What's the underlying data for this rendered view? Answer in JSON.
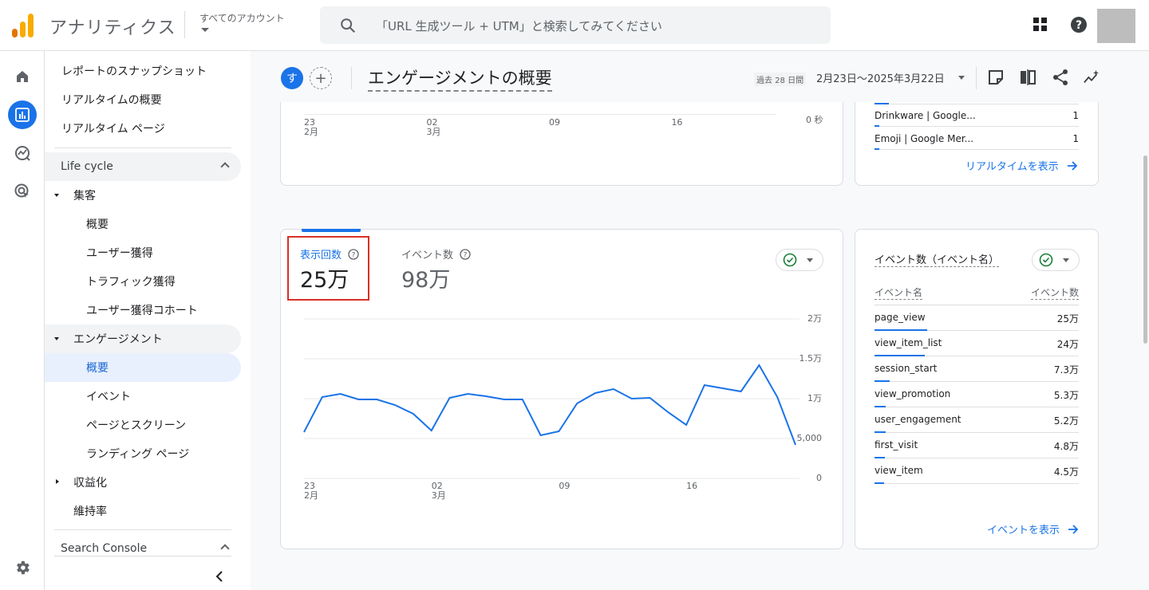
{
  "topbar": {
    "app_title": "アナリティクス",
    "account_label": "すべてのアカウント",
    "search_placeholder": "「URL 生成ツール + UTM」と検索してみてください"
  },
  "rail": {
    "items": [
      "home-icon",
      "reports-icon",
      "explore-icon",
      "advertising-icon"
    ],
    "settings": "settings-icon"
  },
  "sidenav": {
    "snapshot": "レポートのスナップショット",
    "realtime_overview": "リアルタイムの概要",
    "realtime_pages": "リアルタイム ページ",
    "lifecycle": "Life cycle",
    "acquisition": "集客",
    "acq_overview": "概要",
    "user_acq": "ユーザー獲得",
    "traffic_acq": "トラフィック獲得",
    "user_acq_cohort": "ユーザー獲得コホート",
    "engagement": "エンゲージメント",
    "eng_overview": "概要",
    "events": "イベント",
    "pages_screens": "ページとスクリーン",
    "landing_page": "ランディング ページ",
    "monetization": "収益化",
    "retention": "維持率",
    "search_console": "Search Console"
  },
  "header": {
    "segment_chip": "す",
    "add_chip": "+",
    "page_title": "エンゲージメントの概要",
    "date_label": "過去 28 日間",
    "date_range": "2月23日〜2025年3月22日"
  },
  "top_card": {
    "x_ticks": [
      {
        "day": "23",
        "month": "2月"
      },
      {
        "day": "02",
        "month": "3月"
      },
      {
        "day": "09",
        "month": ""
      },
      {
        "day": "16",
        "month": ""
      }
    ],
    "y_zero": "0 秒"
  },
  "realtime_card": {
    "rows": [
      {
        "name": "Drinkware | Google...",
        "value": "1"
      },
      {
        "name": "Emoji | Google Mer...",
        "value": "1"
      }
    ],
    "link": "リアルタイムを表示"
  },
  "views_card": {
    "metric1_label": "表示回数",
    "metric1_value": "25万",
    "metric2_label": "イベント数",
    "metric2_value": "98万",
    "y_ticks": [
      "2万",
      "1.5万",
      "1万",
      "5,000",
      "0"
    ],
    "x_ticks": [
      {
        "day": "23",
        "month": "2月"
      },
      {
        "day": "02",
        "month": "3月"
      },
      {
        "day": "09",
        "month": ""
      },
      {
        "day": "16",
        "month": ""
      }
    ]
  },
  "chart_data": {
    "type": "line",
    "title": "",
    "xlabel": "",
    "ylabel": "",
    "ylim": [
      0,
      20000
    ],
    "x": [
      "2月23日",
      "2月24日",
      "2月25日",
      "2月26日",
      "2月27日",
      "2月28日",
      "3月1日",
      "3月2日",
      "3月3日",
      "3月4日",
      "3月5日",
      "3月6日",
      "3月7日",
      "3月8日",
      "3月9日",
      "3月10日",
      "3月11日",
      "3月12日",
      "3月13日",
      "3月14日",
      "3月15日",
      "3月16日",
      "3月17日",
      "3月18日",
      "3月19日",
      "3月20日",
      "3月21日",
      "3月22日"
    ],
    "series": [
      {
        "name": "表示回数",
        "values": [
          5800,
          10200,
          10600,
          9900,
          9900,
          9200,
          8100,
          6000,
          10100,
          10600,
          10300,
          9900,
          9900,
          5400,
          5900,
          9400,
          10700,
          11200,
          10000,
          10100,
          8300,
          6700,
          11700,
          11300,
          10900,
          14200,
          10200,
          4200
        ]
      }
    ],
    "grid": true
  },
  "events_card": {
    "title_part1": "イベント数",
    "title_part2": "（イベント名）",
    "col_name": "イベント名",
    "col_value": "イベント数",
    "rows": [
      {
        "name": "page_view",
        "value": "25万",
        "share": 1.0
      },
      {
        "name": "view_item_list",
        "value": "24万",
        "share": 0.96
      },
      {
        "name": "session_start",
        "value": "7.3万",
        "share": 0.29
      },
      {
        "name": "view_promotion",
        "value": "5.3万",
        "share": 0.21
      },
      {
        "name": "user_engagement",
        "value": "5.2万",
        "share": 0.21
      },
      {
        "name": "first_visit",
        "value": "4.8万",
        "share": 0.19
      },
      {
        "name": "view_item",
        "value": "4.5万",
        "share": 0.18
      }
    ],
    "link": "イベントを表示"
  },
  "colors": {
    "accent": "#1a73e8",
    "highlight_box": "#d93025",
    "logo_orange": "#f9ab00",
    "logo_dark_orange": "#e37400",
    "check_green": "#188038"
  }
}
